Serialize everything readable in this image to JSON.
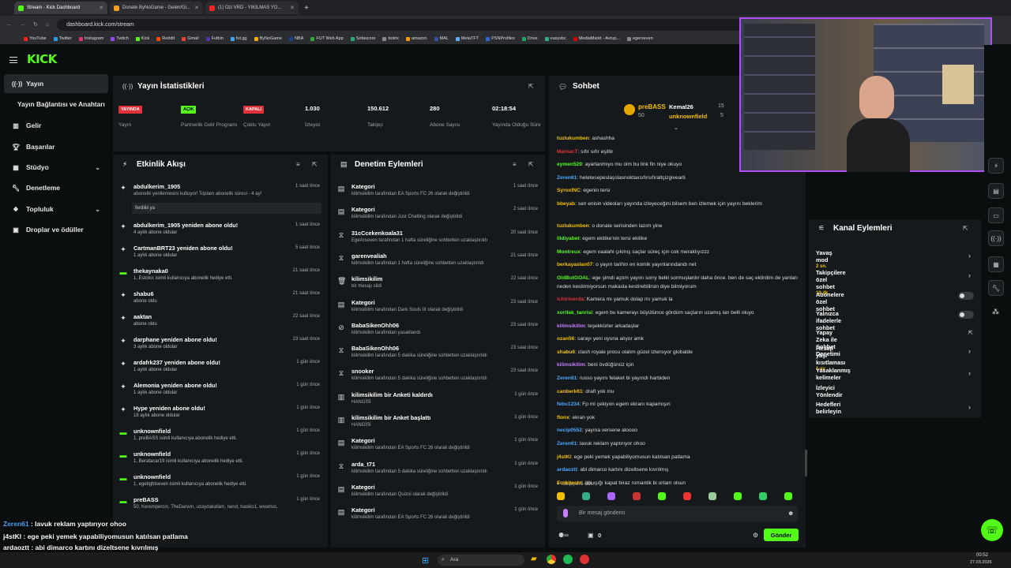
{
  "browser": {
    "tabs": [
      {
        "title": "Stream - Kick Dashboard",
        "color": "#53fc18"
      },
      {
        "title": "Donate ByNoGame - Gelen/Gi...",
        "color": "#f0a020"
      },
      {
        "title": "(1) Ozi VRD - YIKILMAS YO...",
        "color": "#ff2020"
      }
    ],
    "url": "dashboard.kick.com/stream",
    "bookmarks": [
      "YouTube",
      "Twitter",
      "Instagram",
      "Twitch",
      "Kick",
      "Reddit",
      "Gmail",
      "Futbin",
      "fut.gg",
      "ByNoGame",
      "NBA",
      "FUT Web App",
      "Sofascore",
      "botrix",
      "amazon",
      "MAL",
      "MetaTFT",
      "PSNProfiles",
      "Drive",
      "easysbc",
      "MediaMarkt - Avrup...",
      "egerseven"
    ]
  },
  "logo": "KICK",
  "sidebar": {
    "items": [
      {
        "label": "Yayın",
        "icon": "broadcast-icon"
      },
      {
        "label": "Yayın Bağlantısı ve Anahtarı",
        "icon": ""
      },
      {
        "label": "Gelir",
        "icon": "chart-icon"
      },
      {
        "label": "Başarılar",
        "icon": "trophy-icon"
      },
      {
        "label": "Stüdyo",
        "icon": "grid-icon"
      },
      {
        "label": "Denetleme",
        "icon": "wrench-icon"
      },
      {
        "label": "Topluluk",
        "icon": "community-icon"
      },
      {
        "label": "Droplar ve ödüller",
        "icon": "gift-icon"
      }
    ]
  },
  "stats": {
    "title": "Yayın İstatistikleri",
    "items": [
      {
        "tag": "YAYINDA",
        "tag_bg": "#e0313b",
        "tag_fg": "#ffffff",
        "label": "Yayın"
      },
      {
        "tag": "AÇIK",
        "tag_bg": "#53fc18",
        "tag_fg": "#000000",
        "label": "Partnerlik Gelir Programı"
      },
      {
        "tag": "KAPALI",
        "tag_bg": "#e0313b",
        "tag_fg": "#ffffff",
        "label": "Çoklu Yayın"
      },
      {
        "value": "1.030",
        "label": "İzleyici"
      },
      {
        "value": "150.612",
        "label": "Takipçi"
      },
      {
        "value": "280",
        "label": "Abone Sayısı"
      },
      {
        "value": "02:18:54",
        "label": "Yayında Olduğu Süre"
      }
    ]
  },
  "activity": {
    "title": "Etkinlik Akışı",
    "items": [
      {
        "title": "abdulkerim_1905",
        "sub": "abonelik yenilemesini kutluyor! Toplam abonelik süresi - 4 ay!",
        "time": "1 saat önce",
        "note": "ferdiiiii ya"
      },
      {
        "title": "abdulkerim_1905 yeniden abone oldu!",
        "sub": "4 aylık abone oldular",
        "time": "1 saat önce"
      },
      {
        "title": "CartmanBRT23 yeniden abone oldu!",
        "sub": "1 aylık abone oldular",
        "time": "5 saat önce"
      },
      {
        "title": "thekaynaka0",
        "sub": "1, Estolcc isimli kullanıcıya abonelik hediye etti.",
        "time": "21 saat önce"
      },
      {
        "title": "shabu6",
        "sub": "abone oldu",
        "time": "21 saat önce"
      },
      {
        "title": "aaktan",
        "sub": "abone oldu",
        "time": "22 saat önce"
      },
      {
        "title": "darphane yeniden abone oldu!",
        "sub": "3 aylık abone oldular",
        "time": "23 saat önce"
      },
      {
        "title": "ardafrk237 yeniden abone oldu!",
        "sub": "1 aylık abone oldular",
        "time": "1 gün önce"
      },
      {
        "title": "Alemonia yeniden abone oldu!",
        "sub": "1 aylık abone oldular",
        "time": "1 gün önce"
      },
      {
        "title": "Hype yeniden abone oldu!",
        "sub": "18 aylık abone oldular",
        "time": "1 gün önce"
      },
      {
        "title": "unknownfield",
        "sub": "1, preBASS isimli kullanıcıya abonelik hediye etti.",
        "time": "1 gün önce"
      },
      {
        "title": "unknownfield",
        "sub": "1, Beratacar19 isimli kullanıcıya abonelik hediye etti.",
        "time": "1 gün önce"
      },
      {
        "title": "unknownfield",
        "sub": "1, egetightseven isimli kullanıcıya abonelik hediye etti.",
        "time": "1 gün önce"
      },
      {
        "title": "preBASS",
        "sub": "50, Kerempercin, TheDarwin, uzaydakafam, nend, hasiko1, wixerlus,",
        "time": "1 gün önce"
      }
    ]
  },
  "moderation": {
    "title": "Denetim Eylemleri",
    "items": [
      {
        "title": "Kategori",
        "sub": "kilimsikilim tarafından EA Sports FC 26 olarak değiştirildi",
        "time": "1 saat önce"
      },
      {
        "title": "Kategori",
        "sub": "kilimsikilim tarafından Just Chatting olarak değiştirildi",
        "time": "2 saat önce"
      },
      {
        "title": "31cCcekenkoala31",
        "sub": "EgeArseven tarafından 1 hafta süreliğine sohbetten uzaklaştırıldı",
        "time": "20 saat önce"
      },
      {
        "title": "garenvealiah",
        "sub": "kilimsikilim tarafından 1 hafta süreliğine sohbetten uzaklaştırıldı",
        "time": "21 saat önce"
      },
      {
        "title": "kilimsikilim",
        "sub": "bir mesajı sildi",
        "time": "22 saat önce"
      },
      {
        "title": "Kategori",
        "sub": "kilimsikilim tarafından Dark Souls III olarak değiştirildi",
        "time": "23 saat önce"
      },
      {
        "title": "BabaSikenOhh06",
        "sub": "kilimsikilim tarafından yasaklandı",
        "time": "23 saat önce"
      },
      {
        "title": "BabaSikenOhh06",
        "sub": "kilimsikilim tarafından 5 dakika süreliğine sohbetten uzaklaştırıldı",
        "time": "23 saat önce"
      },
      {
        "title": "snooker",
        "sub": "kilimsikilim tarafından 5 dakika süreliğine sohbetten uzaklaştırıldı",
        "time": "23 saat önce"
      },
      {
        "title": "kilimsikilim bir Anketi kaldırdı",
        "sub": "HANGİSİ",
        "time": "1 gün önce"
      },
      {
        "title": "kilimsikilim bir Anket başlattı",
        "sub": "HANGİSİ",
        "time": "1 gün önce"
      },
      {
        "title": "Kategori",
        "sub": "kilimsikilim tarafından EA Sports FC 26 olarak değiştirildi",
        "time": "1 gün önce"
      },
      {
        "title": "arda_t71",
        "sub": "kilimsikilim tarafından 5 dakika süreliğine sohbetten uzaklaştırıldı",
        "time": "1 gün önce"
      },
      {
        "title": "Kategori",
        "sub": "kilimsikilim tarafından Quizoi olarak değiştirildi",
        "time": "1 gün önce"
      },
      {
        "title": "Kategori",
        "sub": "kilimsikilim tarafından EA Sports FC 26 olarak değiştirildi",
        "time": "1 gün önce"
      }
    ]
  },
  "chat": {
    "title": "Sohbet",
    "top": [
      {
        "name": "preBASS",
        "count": "50"
      },
      {
        "name": "Kemal26",
        "count": "15"
      },
      {
        "name": "unknownfield",
        "count": "5"
      }
    ],
    "messages": [
      {
        "user": "tuzlukumben",
        "color": "#f2c000",
        "text": "ashashha"
      },
      {
        "user": "ManiacT",
        "color": "#e0313b",
        "text": "sıfır sıfır eşittir"
      },
      {
        "user": "eymen529",
        "color": "#53fc18",
        "text": "ayarlanmıyo mu olm bu link fln niye okuyo"
      },
      {
        "user": "Zeren61",
        "color": "#4aa8ff",
        "text": "hetetesepeslaşslasnoktaxsıfırsıfıraltçizgivearti"
      },
      {
        "user": "SyroxINC",
        "color": "#f2c000",
        "text": "egenin tersi"
      },
      {
        "user": "bbeyab",
        "color": "#f2c000",
        "text": "sen enisin videoları yayında izleyeceğini bilsem ben izlemek için yayını beklerim"
      },
      {
        "user": "tuzlukumben",
        "color": "#f2c000",
        "text": "o donate serisinden lazım yine"
      },
      {
        "user": "lildiyabet",
        "color": "#53fc18",
        "text": "egem ekitike'nin tersi ekitike"
      },
      {
        "user": "Montreux",
        "color": "#53fc18",
        "text": "egem vaalahi çıkmış saçlar süreç için cok meraklıyızzz"
      },
      {
        "user": "berkayaslan07",
        "color": "#f2c000",
        "text": "o yayın tarihin en komik yayınlarındandı net"
      },
      {
        "user": "OldButGOAL",
        "color": "#53fc18",
        "text": "ege şimdi açtım yayını sorry belki sormuşlardır daha önce. ben de saç ektirdim de yanları neden kestirmiyorsun makasla kestirebilirsin diye bilmiyorum"
      },
      {
        "user": "ichtrinerda",
        "color": "#e0313b",
        "text": "Kamera mı yamuk dolap mı yamuk la"
      },
      {
        "user": "xortlak_tanrisi",
        "color": "#53fc18",
        "text": "egem bu kamerayı büyütünce gördüm saçların uzamış lan belli oluyo"
      },
      {
        "user": "kilimsikilim",
        "color": "#c77dff",
        "text": "teşekkürler arkadaşlar"
      },
      {
        "user": "ozan56",
        "color": "#f2c000",
        "text": "sarayı yeni oyuna alıyor amk"
      },
      {
        "user": "shabu6",
        "color": "#f2c000",
        "text": "clash royale prosu olalım güzel izlensyor globalde"
      },
      {
        "user": "kilimsikilim",
        "color": "#c77dff",
        "text": "beni övdüğünüz için"
      },
      {
        "user": "Zeren61",
        "color": "#4aa8ff",
        "text": "russo yayını felaket bi yayındı harbiden"
      },
      {
        "user": "canberk61",
        "color": "#f2c000",
        "text": "draft yok mu"
      },
      {
        "user": "febu1234",
        "color": "#4aa8ff",
        "text": "Fp mi çekiyon egem ekranı kapamışın"
      },
      {
        "user": "flonx",
        "color": "#f2c000",
        "text": "ekran yok"
      },
      {
        "user": "necip0552",
        "color": "#4aa8ff",
        "text": "yayına versene aloooo"
      },
      {
        "user": "Zeren61",
        "color": "#4aa8ff",
        "text": "lavuk reklam yaptırıyor ohoo"
      },
      {
        "user": "j4stKl",
        "color": "#f2c000",
        "text": "ege peki yemek yapabiliyomusun katılsan patlama"
      },
      {
        "user": "ardaoztt",
        "color": "#4aa8ff",
        "text": "abi dimarco kartını dizeltsene kıvrılmış"
      },
      {
        "user": "Furkitecht",
        "color": "#f2c000",
        "text": "abi ışığı kapat biraz romantik bi ortam olsun"
      }
    ],
    "followers_only": "Takipçilere Özel",
    "placeholder": "Bir mesaj gönderin",
    "send": "Gönder",
    "viewer_count": "0"
  },
  "kanal": {
    "title": "Kanal Eylemleri",
    "rows": [
      {
        "label": "Yavaş mod",
        "sub": "2 sn.",
        "control": "arrow"
      },
      {
        "label": "Takipçilere özel sohbet",
        "sub": "10 dk.",
        "control": "arrow"
      },
      {
        "label": "Abonelere özel sohbet",
        "sub": "",
        "control": "toggle"
      },
      {
        "label": "Yalnızca ifadelerle sohbet",
        "sub": "",
        "control": "toggle"
      },
      {
        "label": "Yapay Zeka ile Sohbet Denetimi",
        "sub": "",
        "control": "external"
      },
      {
        "label": "Hesap yaşı kısıtlaması",
        "sub": "1 ay",
        "control": "arrow"
      },
      {
        "label": "Yasaklanmış kelimeler",
        "sub": "",
        "control": "arrow"
      },
      {
        "label": "İzleyici Yönlendir",
        "sub": "",
        "control": ""
      },
      {
        "label": "Hedefleri belirleyin",
        "sub": "",
        "control": "arrow"
      }
    ]
  },
  "overlay": [
    {
      "user": "Zeren61",
      "color": "#4aa8ff",
      "text": " : lavuk reklam yaptırıyor ohoo"
    },
    {
      "user": "j4stKl",
      "color": "#ffffff",
      "text": " : ege peki yemek yapabiliyomusun katılsan patlama"
    },
    {
      "user": "ardaoztt",
      "color": "#ffffff",
      "text": " : abi dimarco kartını dizeltsene kıvrılmış"
    },
    {
      "user": "Furkitecht",
      "color": "#ffffff",
      "text": " : abi ışığı kapat biraz romantik bi ortam olsun"
    }
  ],
  "taskbar": {
    "search": "Ara",
    "time": "00:52",
    "date": "27.03.2026"
  }
}
